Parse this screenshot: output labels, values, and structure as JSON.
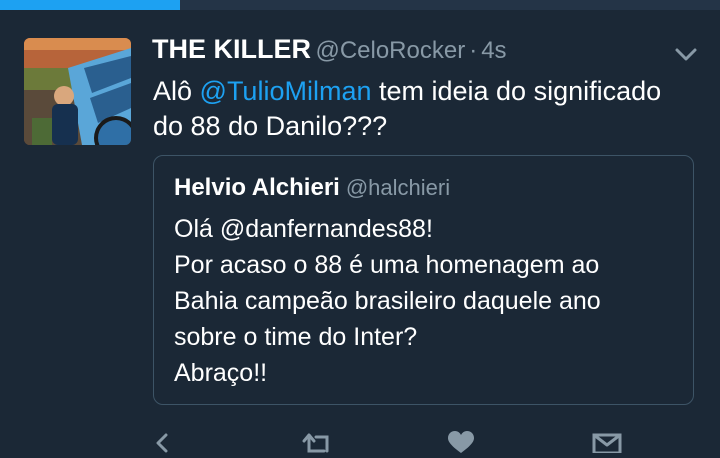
{
  "progress": {
    "fraction": 0.25,
    "color": "#1da1f2"
  },
  "tweet": {
    "avatar_icon": "user-avatar-photo",
    "display_name": "THE KILLER",
    "handle": "@CeloRocker",
    "separator": "·",
    "time": "4s",
    "menu_icon": "chevron-down-icon",
    "text_before": "Alô ",
    "mention": "@TulioMilman",
    "text_after": " tem ideia do significado do 88 do Danilo???"
  },
  "quote": {
    "display_name": "Helvio Alchieri",
    "handle": "@halchieri",
    "lines": [
      "Olá @danfernandes88!",
      "Por acaso o 88 é uma homenagem ao",
      "Bahia campeão brasileiro daquele ano",
      "sobre o time do Inter?",
      "Abraço!!"
    ]
  },
  "actions": {
    "icons": [
      "reply-icon",
      "retweet-icon",
      "like-icon",
      "message-icon"
    ]
  },
  "colors": {
    "background": "#1b2836",
    "accent": "#1da1f2",
    "secondary_text": "#8899a6",
    "border": "#3d5466"
  }
}
